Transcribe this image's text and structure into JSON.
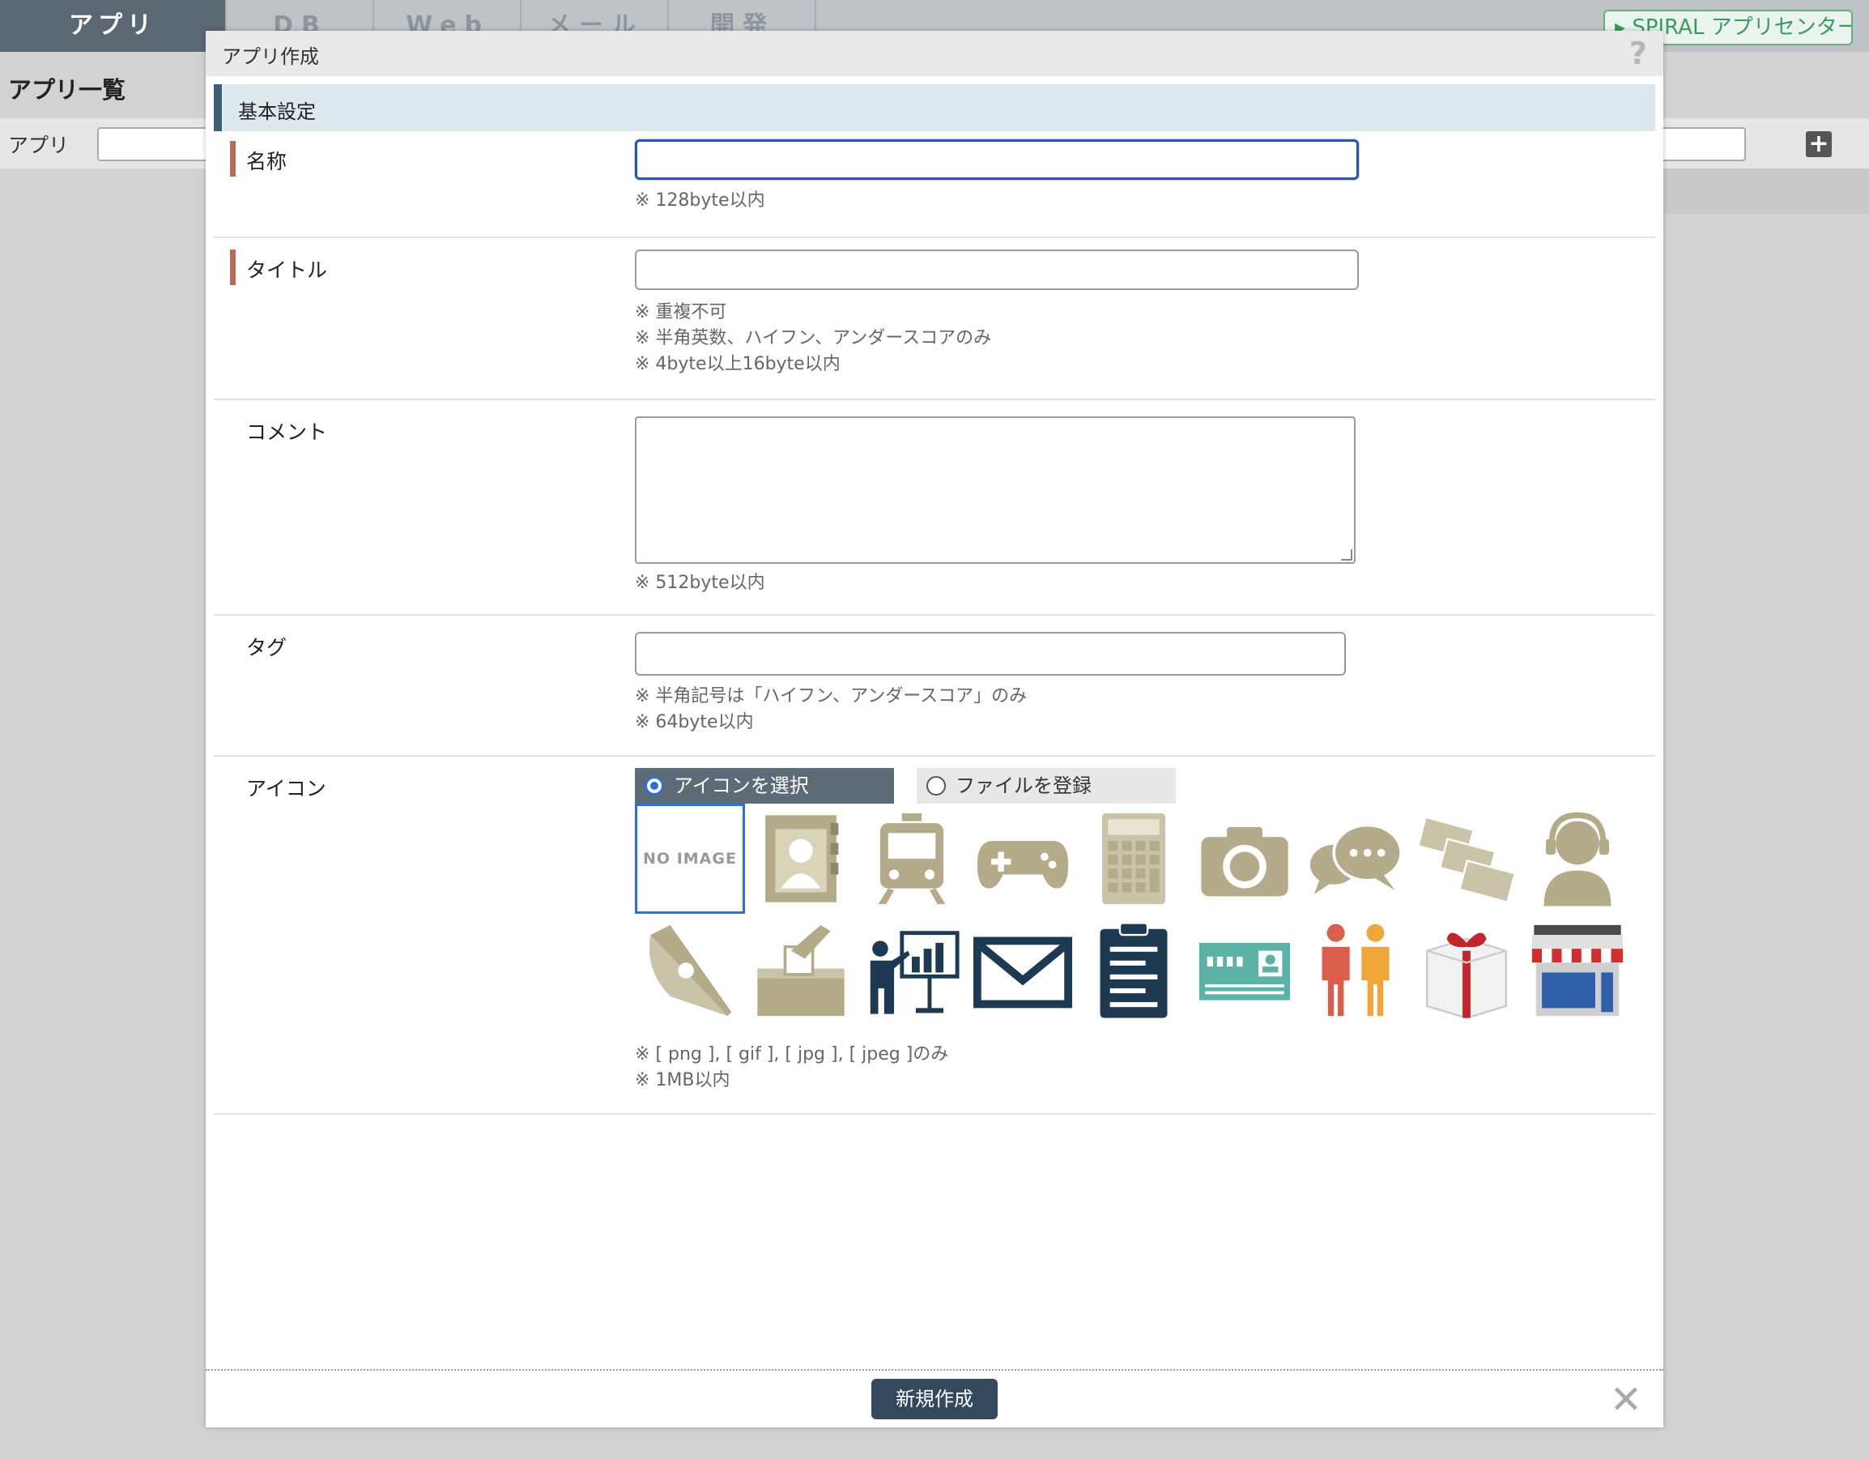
{
  "topnav": {
    "tabs": [
      {
        "label": "アプリ"
      },
      {
        "label": "DB"
      },
      {
        "label": "Web"
      },
      {
        "label": "メール"
      },
      {
        "label": "開発"
      }
    ],
    "app_center_label": "▸ SPIRAL アプリセンター ✈"
  },
  "background": {
    "page_title": "アプリ一覧",
    "bar_label": "アプリ",
    "add_button": "+"
  },
  "modal": {
    "title": "アプリ作成",
    "help": "?",
    "section_title": "基本設定",
    "fields": {
      "name": {
        "label": "名称",
        "value": "",
        "notes": [
          "※ 128byte以内"
        ]
      },
      "title": {
        "label": "タイトル",
        "value": "",
        "notes": [
          "※ 重複不可",
          "※ 半角英数、ハイフン、アンダースコアのみ",
          "※ 4byte以上16byte以内"
        ]
      },
      "comment": {
        "label": "コメント",
        "value": "",
        "notes": [
          "※ 512byte以内"
        ]
      },
      "tag": {
        "label": "タグ",
        "value": "",
        "notes": [
          "※ 半角記号は「ハイフン、アンダースコア」のみ",
          "※ 64byte以内"
        ]
      },
      "icon": {
        "label": "アイコン",
        "option_select": "アイコンを選択",
        "option_file": "ファイルを登録",
        "selected_option": "アイコンを選択",
        "no_image": "NO IMAGE",
        "icons": [
          "no-image",
          "address-book-icon",
          "train-icon",
          "gamepad-icon",
          "calculator-icon",
          "camera-icon",
          "chat-bubbles-icon",
          "cards-icon",
          "operator-icon",
          "fountain-pen-icon",
          "ballot-box-icon",
          "presentation-icon",
          "mail-icon",
          "clipboard-icon",
          "id-card-icon",
          "people-icon",
          "gift-box-icon",
          "shop-icon"
        ],
        "notes": [
          "※ [ png ], [ gif ], [ jpg ], [ jpeg ]のみ",
          "※ 1MB以内"
        ]
      }
    },
    "submit_label": "新規作成",
    "close": "✕"
  },
  "colors": {
    "accent": "#2f6fd8",
    "primary_button": "#34495c",
    "required_marker": "#b76d58",
    "section_bar": "#3e5e74",
    "icon_tan": "#b3ab8a",
    "icon_navy": "#1e3a52"
  }
}
